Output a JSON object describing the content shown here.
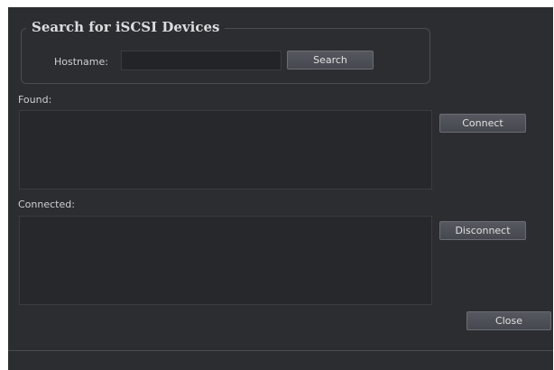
{
  "search_group": {
    "title": "Search for iSCSI Devices",
    "hostname_label": "Hostname:",
    "hostname_value": "",
    "search_label": "Search"
  },
  "found": {
    "label": "Found:",
    "items": [],
    "connect_label": "Connect"
  },
  "connected": {
    "label": "Connected:",
    "items": [],
    "disconnect_label": "Disconnect"
  },
  "footer": {
    "close_label": "Close"
  },
  "colors": {
    "dialog_background": "#2b2d31",
    "list_background": "#26282c",
    "button_background": "#50535a",
    "text": "#d0d0d0"
  }
}
